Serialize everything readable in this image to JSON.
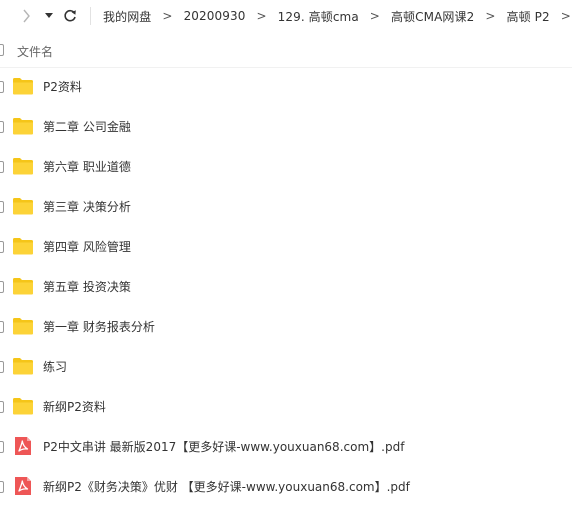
{
  "toolbar": {
    "forward_icon": "chevron-right-icon",
    "dropdown_icon": "caret-down-icon",
    "refresh_icon": "refresh-icon"
  },
  "breadcrumb": [
    "我的网盘",
    "20200930",
    "129. 高顿cma",
    "高顿CMA网课2",
    "高顿 P2"
  ],
  "breadcrumb_separator": ">",
  "list_header": {
    "name_column": "文件名"
  },
  "files": [
    {
      "name": "P2资料",
      "type": "folder"
    },
    {
      "name": "第二章 公司金融",
      "type": "folder"
    },
    {
      "name": "第六章  职业道德",
      "type": "folder"
    },
    {
      "name": "第三章 决策分析",
      "type": "folder"
    },
    {
      "name": "第四章 风险管理",
      "type": "folder"
    },
    {
      "name": "第五章 投资决策",
      "type": "folder"
    },
    {
      "name": "第一章 财务报表分析",
      "type": "folder"
    },
    {
      "name": "练习",
      "type": "folder"
    },
    {
      "name": "新纲P2资料",
      "type": "folder"
    },
    {
      "name": "P2中文串讲 最新版2017【更多好课-www.youxuan68.com】.pdf",
      "type": "pdf"
    },
    {
      "name": "新纲P2《财务决策》优财 【更多好课-www.youxuan68.com】.pdf",
      "type": "pdf"
    }
  ],
  "colors": {
    "folder": "#fcd337",
    "folder_tab": "#f5c518",
    "pdf": "#ee5656"
  }
}
